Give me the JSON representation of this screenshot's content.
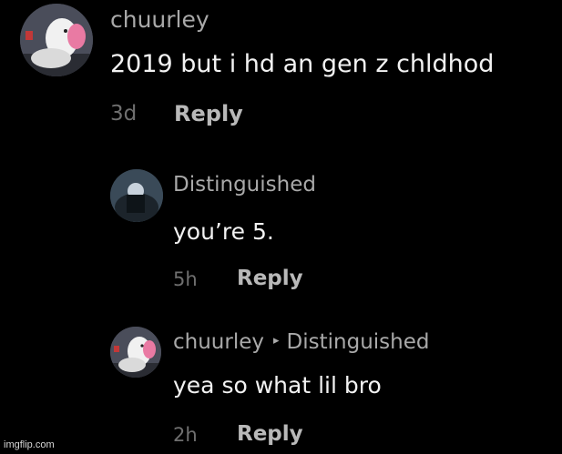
{
  "comments": [
    {
      "username": "chuurley",
      "text": "2019 but i hd an gen z chldhod",
      "time": "3d",
      "reply_label": "Reply",
      "avatar_icon": "snoopy-avatar-icon"
    },
    {
      "username": "Distinguished",
      "text": "you’re 5.",
      "time": "5h",
      "reply_label": "Reply",
      "avatar_icon": "dark-photo-avatar-icon"
    },
    {
      "username": "chuurley",
      "reply_to": "Distinguished",
      "caret": "▸",
      "text": "yea so what lil bro",
      "time": "2h",
      "reply_label": "Reply",
      "avatar_icon": "snoopy-avatar-icon"
    }
  ],
  "watermark": "imgflip.com",
  "colors": {
    "background": "#000000",
    "text": "#f2f2f2",
    "username": "#a9a9a9",
    "time": "#6f6f6f",
    "reply": "#b9b9b9"
  }
}
